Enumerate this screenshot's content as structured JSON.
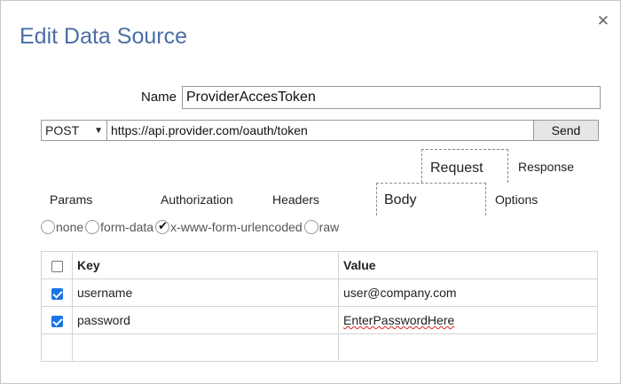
{
  "dialog": {
    "title": "Edit Data Source",
    "close_icon": "close-icon"
  },
  "name": {
    "label": "Name",
    "value": "ProviderAccesToken"
  },
  "request": {
    "method": "POST",
    "url": "https://api.provider.com/oauth/token",
    "send_label": "Send"
  },
  "top_tabs": {
    "request": "Request",
    "response": "Response"
  },
  "sub_tabs": {
    "params": "Params",
    "authorization": "Authorization",
    "headers": "Headers",
    "body": "Body",
    "options": "Options"
  },
  "body_types": [
    {
      "label": "none",
      "checked": false
    },
    {
      "label": "form-data",
      "checked": false
    },
    {
      "label": "x-www-form-urlencoded",
      "checked": true
    },
    {
      "label": "raw",
      "checked": false
    }
  ],
  "table": {
    "headers": {
      "key": "Key",
      "value": "Value"
    },
    "rows": [
      {
        "checked": true,
        "key": "username",
        "value": "user@company.com"
      },
      {
        "checked": true,
        "key": "password",
        "value": "EnterPasswordHere"
      },
      {
        "checked": false,
        "key": "",
        "value": ""
      }
    ]
  },
  "colors": {
    "title": "#4a6fa5",
    "checkbox_accent": "#1a73e8"
  }
}
